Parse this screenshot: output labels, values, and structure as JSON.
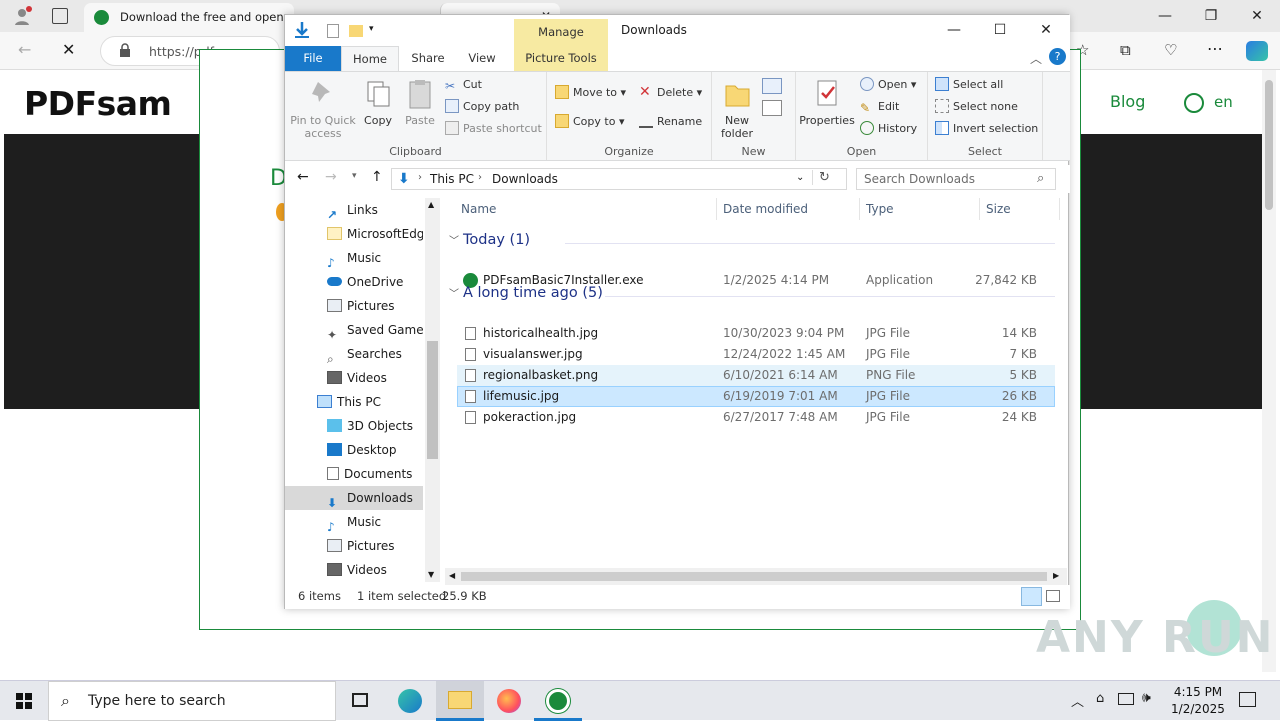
{
  "browser": {
    "tab_title": "Download the free and open sc",
    "url": "https://pdf...",
    "site": {
      "logo": "PDFsam",
      "nav_blog": "Blog",
      "nav_lang": "en",
      "heading_fragment": "D"
    },
    "watermark": "ANY RUN"
  },
  "explorer": {
    "manage_label": "Manage",
    "window_title": "Downloads",
    "tabs": {
      "file": "File",
      "home": "Home",
      "share": "Share",
      "view": "View",
      "picture_tools": "Picture Tools"
    },
    "clipboard": {
      "pin": "Pin to Quick access",
      "copy": "Copy",
      "paste": "Paste",
      "cut": "Cut",
      "copy_path": "Copy path",
      "paste_shortcut": "Paste shortcut",
      "label": "Clipboard"
    },
    "organize": {
      "move_to": "Move to",
      "copy_to": "Copy to",
      "delete": "Delete",
      "rename": "Rename",
      "label": "Organize"
    },
    "new": {
      "new_folder": "New folder",
      "label": "New"
    },
    "open": {
      "properties": "Properties",
      "open": "Open",
      "edit": "Edit",
      "history": "History",
      "label": "Open"
    },
    "select": {
      "select_all": "Select all",
      "select_none": "Select none",
      "invert": "Invert selection",
      "label": "Select"
    },
    "path": {
      "root": "This PC",
      "current": "Downloads"
    },
    "search_placeholder": "Search Downloads",
    "nav_items": [
      "Links",
      "MicrosoftEdge",
      "Music",
      "OneDrive",
      "Pictures",
      "Saved Games",
      "Searches",
      "Videos",
      "This PC",
      "3D Objects",
      "Desktop",
      "Documents",
      "Downloads",
      "Music",
      "Pictures",
      "Videos"
    ],
    "columns": {
      "name": "Name",
      "date": "Date modified",
      "type": "Type",
      "size": "Size"
    },
    "groups": [
      {
        "title": "Today (1)",
        "files": [
          {
            "name": "PDFsamBasic7Installer.exe",
            "date": "1/2/2025 4:14 PM",
            "type": "Application",
            "size": "27,842 KB"
          }
        ]
      },
      {
        "title": "A long time ago (5)",
        "files": [
          {
            "name": "historicalhealth.jpg",
            "date": "10/30/2023 9:04 PM",
            "type": "JPG File",
            "size": "14 KB"
          },
          {
            "name": "visualanswer.jpg",
            "date": "12/24/2022 1:45 AM",
            "type": "JPG File",
            "size": "7 KB"
          },
          {
            "name": "regionalbasket.png",
            "date": "6/10/2021 6:14 AM",
            "type": "PNG File",
            "size": "5 KB"
          },
          {
            "name": "lifemusic.jpg",
            "date": "6/19/2019 7:01 AM",
            "type": "JPG File",
            "size": "26 KB"
          },
          {
            "name": "pokeraction.jpg",
            "date": "6/27/2017 7:48 AM",
            "type": "JPG File",
            "size": "24 KB"
          }
        ]
      }
    ],
    "status": {
      "count": "6 items",
      "selected": "1 item selected",
      "size": "25.9 KB"
    }
  },
  "taskbar": {
    "search_placeholder": "Type here to search",
    "time": "4:15 PM",
    "date": "1/2/2025"
  },
  "colors": {
    "accent": "#1979ca",
    "manage": "#f7eaa2",
    "selection": "#cce8ff",
    "brand_green": "#1a8a3b"
  }
}
